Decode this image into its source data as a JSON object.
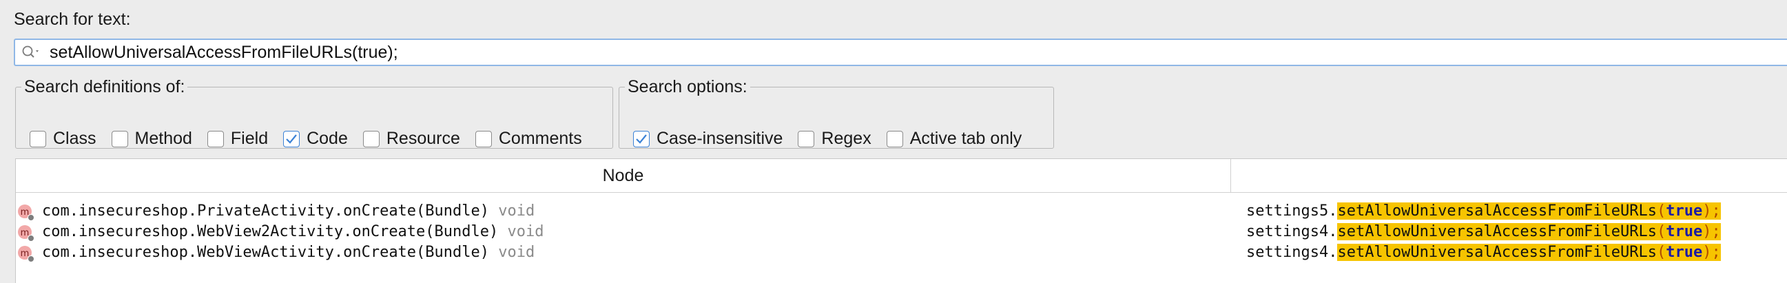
{
  "search": {
    "label": "Search for text:",
    "value": "setAllowUniversalAccessFromFileURLs(true);",
    "icon": "search-icon"
  },
  "definitions": {
    "title": "Search definitions of:",
    "options": [
      {
        "label": "Class",
        "checked": false
      },
      {
        "label": "Method",
        "checked": false
      },
      {
        "label": "Field",
        "checked": false
      },
      {
        "label": "Code",
        "checked": true
      },
      {
        "label": "Resource",
        "checked": false
      },
      {
        "label": "Comments",
        "checked": false
      }
    ]
  },
  "search_options": {
    "title": "Search options:",
    "options": [
      {
        "label": "Case-insensitive",
        "checked": true
      },
      {
        "label": "Regex",
        "checked": false
      },
      {
        "label": "Active tab only",
        "checked": false
      }
    ]
  },
  "results": {
    "column_node": "Node",
    "column_code": "",
    "rows": [
      {
        "node": "com.insecureshop.PrivateActivity.onCreate(Bundle)",
        "ret": "void",
        "code_prefix": "settings5.",
        "code_method": "setAllowUniversalAccessFromFileURLs",
        "code_open": "(",
        "code_arg": "true",
        "code_close": ");"
      },
      {
        "node": "com.insecureshop.WebView2Activity.onCreate(Bundle)",
        "ret": "void",
        "code_prefix": "settings4.",
        "code_method": "setAllowUniversalAccessFromFileURLs",
        "code_open": "(",
        "code_arg": "true",
        "code_close": ");"
      },
      {
        "node": "com.insecureshop.WebViewActivity.onCreate(Bundle)",
        "ret": "void",
        "code_prefix": "settings4.",
        "code_method": "setAllowUniversalAccessFromFileURLs",
        "code_open": "(",
        "code_arg": "true",
        "code_close": ");"
      }
    ]
  },
  "colors": {
    "highlight": "#f7c400",
    "keyword": "#1a1aa6",
    "accent": "#3b82d6",
    "method_icon": "#f2a8a8"
  }
}
